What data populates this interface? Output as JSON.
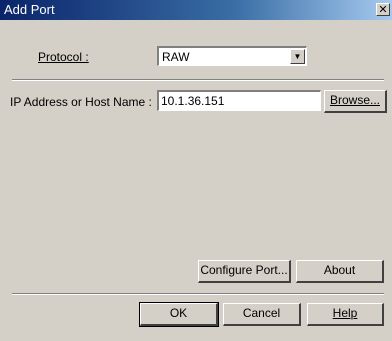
{
  "window": {
    "title": "Add Port",
    "close_glyph": "✕"
  },
  "protocol": {
    "label": "Protocol :",
    "value": "RAW",
    "arrow_icon": "chevron-down-icon"
  },
  "address": {
    "label": "IP Address or Host Name :",
    "value": "10.1.36.151"
  },
  "buttons": {
    "browse": "Browse...",
    "configure_port": "Configure Port...",
    "about": "About",
    "ok": "OK",
    "cancel": "Cancel",
    "help": "Help"
  }
}
